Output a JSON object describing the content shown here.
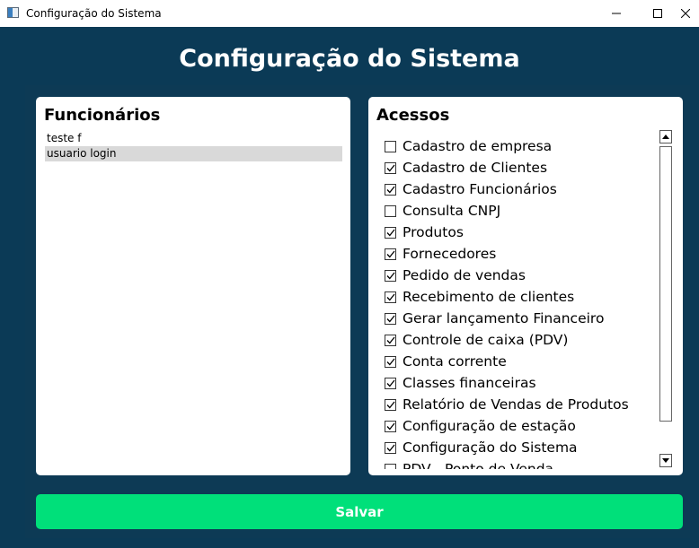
{
  "window": {
    "title": "Configuração do Sistema",
    "controls": [
      "minimize-icon",
      "maximize-icon",
      "close-icon"
    ]
  },
  "page": {
    "title": "Configuração do Sistema"
  },
  "employees": {
    "heading": "Funcionários",
    "items": [
      {
        "label": "teste f",
        "selected": false
      },
      {
        "label": "usuario login",
        "selected": true
      }
    ]
  },
  "access": {
    "heading": "Acessos",
    "items": [
      {
        "label": "Cadastro de empresa",
        "checked": false
      },
      {
        "label": "Cadastro de Clientes",
        "checked": true
      },
      {
        "label": "Cadastro Funcionários",
        "checked": true
      },
      {
        "label": "Consulta CNPJ",
        "checked": false
      },
      {
        "label": "Produtos",
        "checked": true
      },
      {
        "label": "Fornecedores",
        "checked": true
      },
      {
        "label": "Pedido de vendas",
        "checked": true
      },
      {
        "label": "Recebimento de clientes",
        "checked": true
      },
      {
        "label": "Gerar lançamento Financeiro",
        "checked": true
      },
      {
        "label": "Controle de caixa (PDV)",
        "checked": true
      },
      {
        "label": "Conta corrente",
        "checked": true
      },
      {
        "label": "Classes financeiras",
        "checked": true
      },
      {
        "label": "Relatório de Vendas de Produtos",
        "checked": true
      },
      {
        "label": "Configuração de estação",
        "checked": true
      },
      {
        "label": "Configuração do Sistema",
        "checked": true
      },
      {
        "label": "PDV - Ponto de Venda",
        "checked": false
      }
    ]
  },
  "actions": {
    "save_label": "Salvar"
  },
  "colors": {
    "background": "#0b3a56",
    "accent": "#00e07a",
    "selection": "#d9d9d9"
  }
}
